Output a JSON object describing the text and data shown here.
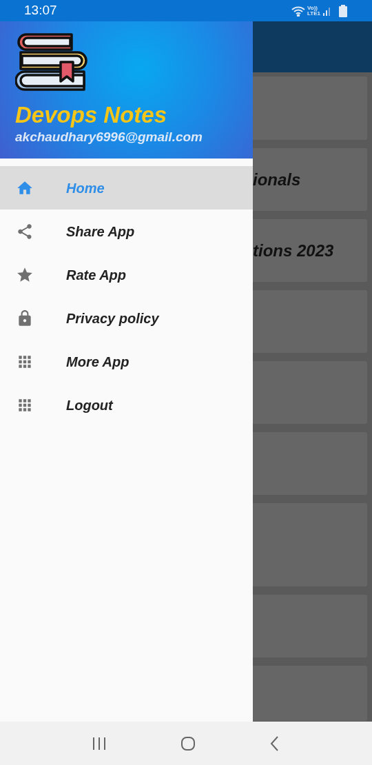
{
  "status_bar": {
    "time": "13:07",
    "volte": "Vo))",
    "network": "LTE1"
  },
  "drawer": {
    "title": "Devops Notes",
    "email": "akchaudhary6996@gmail.com",
    "items": [
      {
        "label": "Home",
        "kind": "home",
        "selected": true
      },
      {
        "label": "Share App",
        "kind": "share",
        "selected": false
      },
      {
        "label": "Rate App",
        "kind": "star",
        "selected": false
      },
      {
        "label": "Privacy policy",
        "kind": "lock",
        "selected": false
      },
      {
        "label": "More App",
        "kind": "grid",
        "selected": false
      },
      {
        "label": "Logout",
        "kind": "grid",
        "selected": false
      }
    ]
  },
  "background_cards": [
    {
      "kind": "blank"
    },
    {
      "kind": "titled",
      "title": "ionals"
    },
    {
      "kind": "titled",
      "title": "tions 2023"
    },
    {
      "kind": "blank"
    },
    {
      "kind": "blank"
    },
    {
      "kind": "blank"
    },
    {
      "kind": "blank"
    },
    {
      "kind": "blank"
    },
    {
      "kind": "blank"
    }
  ]
}
